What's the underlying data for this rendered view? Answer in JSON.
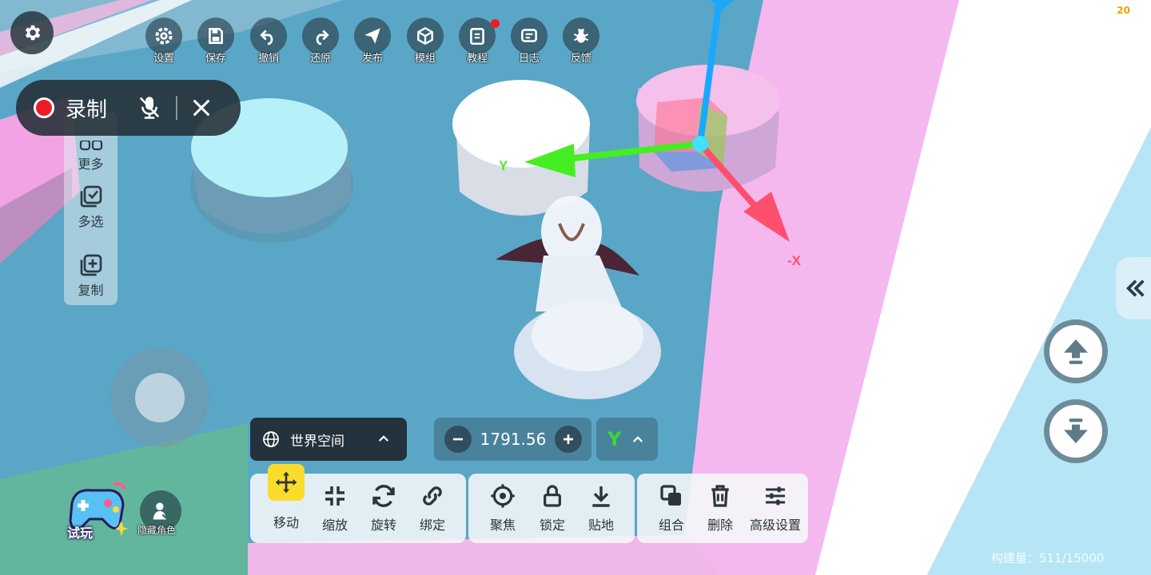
{
  "topbar": {
    "items": [
      {
        "id": "settings",
        "label": "设置",
        "icon": "gear-icon"
      },
      {
        "id": "save",
        "label": "保存",
        "icon": "save-icon"
      },
      {
        "id": "undo",
        "label": "撤销",
        "icon": "undo-icon"
      },
      {
        "id": "redo",
        "label": "还原",
        "icon": "redo-icon"
      },
      {
        "id": "publish",
        "label": "发布",
        "icon": "paper-plane-icon"
      },
      {
        "id": "module",
        "label": "模组",
        "icon": "cube-icon"
      },
      {
        "id": "tutorial",
        "label": "教程",
        "icon": "book-icon",
        "badge": true
      },
      {
        "id": "log",
        "label": "日志",
        "icon": "message-icon"
      },
      {
        "id": "feedback",
        "label": "反馈",
        "icon": "bug-icon"
      }
    ]
  },
  "record": {
    "label": "录制",
    "dot_color": "#ee1c24"
  },
  "left_menu": {
    "items": [
      {
        "id": "more",
        "label": "更多",
        "icon": "grid-icon"
      },
      {
        "id": "multiselect",
        "label": "多选",
        "icon": "multi-select-icon"
      },
      {
        "id": "copy",
        "label": "复制",
        "icon": "copy-icon"
      }
    ]
  },
  "space": {
    "label": "世界空间",
    "icon": "globe-icon"
  },
  "value": {
    "number": "1791.56"
  },
  "axis": {
    "letter": "Y"
  },
  "toolbar": {
    "groups": [
      [
        {
          "id": "move",
          "label": "移动",
          "icon": "move-arrows-icon",
          "active": true
        },
        {
          "id": "scale",
          "label": "缩放",
          "icon": "shrink-icon"
        },
        {
          "id": "rotate",
          "label": "旋转",
          "icon": "rotate-icon"
        },
        {
          "id": "bind",
          "label": "绑定",
          "icon": "link-icon"
        }
      ],
      [
        {
          "id": "focus",
          "label": "聚焦",
          "icon": "crosshair-icon"
        },
        {
          "id": "lock",
          "label": "锁定",
          "icon": "lock-icon"
        },
        {
          "id": "snap-ground",
          "label": "贴地",
          "icon": "download-arrow-icon"
        }
      ],
      [
        {
          "id": "group",
          "label": "组合",
          "icon": "group-icon"
        },
        {
          "id": "delete",
          "label": "删除",
          "icon": "trash-icon"
        },
        {
          "id": "advanced",
          "label": "高级设置",
          "icon": "sliders-icon"
        }
      ]
    ]
  },
  "gizmo": {
    "y_label": "Y",
    "x_label": "-X",
    "y_color": "#44ee22",
    "x_color": "#ff4f6e",
    "z_color": "#1aa8ff"
  },
  "play": {
    "label": "试玩"
  },
  "hide_role": {
    "label": "隐藏角色"
  },
  "fps": "20",
  "build_count": "构建量：511/15000",
  "colors": {
    "accent_yellow": "#fadc2c",
    "record_red": "#ee1c24"
  }
}
